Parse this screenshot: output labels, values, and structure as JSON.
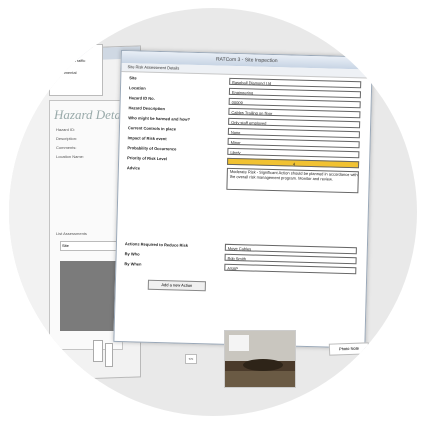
{
  "window": {
    "title": "RATCom 3 - Site Inspection",
    "menu": "Site Risk Assessment Details"
  },
  "tree": {
    "items": [
      "Hazard List",
      "Site/Location",
      "Construction Traffic",
      "Electrical",
      "Environmental"
    ]
  },
  "hazard_panel": {
    "header": "Hazard Details",
    "labels": [
      "Hazard ID:",
      "Description:",
      "Comments:",
      "Location Name:"
    ],
    "list_label": "List Assessments",
    "list_value": "Site"
  },
  "form": {
    "rows": [
      {
        "label": "Site",
        "value": "Baseball Diamond Ltd"
      },
      {
        "label": "Location",
        "value": "Engineering"
      },
      {
        "label": "Hazard ID No.",
        "value": "00009"
      },
      {
        "label": "Hazard Description",
        "value": "Cables Trailing on floor"
      },
      {
        "label": "Who might be harmed and how?",
        "value": "Only staff employed"
      },
      {
        "label": "Current Controls in place",
        "value": "None"
      },
      {
        "label": "Impact of Risk event",
        "value": "Minor"
      },
      {
        "label": "Probability of Occurrence",
        "value": "Likely"
      },
      {
        "label": "Priority of Risk Level",
        "value": "4"
      },
      {
        "label": "Advice",
        "value": "Moderate Risk - Significant Action should be planned in accordance with the overall risk management program. Monitor and review."
      },
      {
        "label": "Actions Required to Reduce Risk",
        "value": "Move Cables"
      },
      {
        "label": "By Who",
        "value": "Bob Smith"
      },
      {
        "label": "By When",
        "value": "ASAP"
      }
    ],
    "add_action": "Add a new Action"
  },
  "buttons": {
    "small": "<<",
    "right": "Photo Note"
  },
  "colors": {
    "priority_fill": "#f1c232",
    "circle_bg": "#e9e9e9"
  }
}
